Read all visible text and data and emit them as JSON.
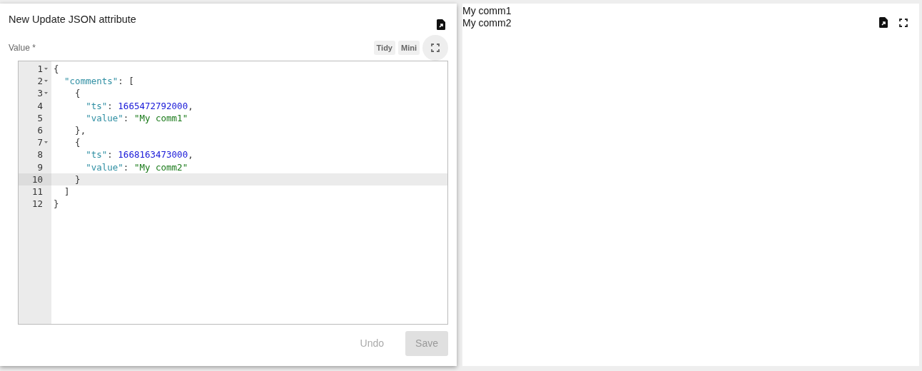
{
  "dialog": {
    "title": "New Update JSON attribute",
    "field_label": "Value *",
    "tools": [
      "Tidy",
      "Mini"
    ],
    "editor": {
      "lines": [
        {
          "number": "1",
          "fold": true,
          "active": false,
          "tokens": [
            {
              "kind": "punct",
              "text": "{"
            }
          ]
        },
        {
          "number": "2",
          "fold": true,
          "active": false,
          "tokens": [
            {
              "kind": "key",
              "text": "  \"comments\""
            },
            {
              "kind": "punct",
              "text": ": ["
            }
          ]
        },
        {
          "number": "3",
          "fold": true,
          "active": false,
          "tokens": [
            {
              "kind": "punct",
              "text": "    {"
            }
          ]
        },
        {
          "number": "4",
          "fold": false,
          "active": false,
          "tokens": [
            {
              "kind": "key",
              "text": "      \"ts\""
            },
            {
              "kind": "punct",
              "text": ": "
            },
            {
              "kind": "number",
              "text": "1665472792000"
            },
            {
              "kind": "punct",
              "text": ","
            }
          ]
        },
        {
          "number": "5",
          "fold": false,
          "active": false,
          "tokens": [
            {
              "kind": "key",
              "text": "      \"value\""
            },
            {
              "kind": "punct",
              "text": ": "
            },
            {
              "kind": "string",
              "text": "\"My comm1\""
            }
          ]
        },
        {
          "number": "6",
          "fold": false,
          "active": false,
          "tokens": [
            {
              "kind": "punct",
              "text": "    },"
            }
          ]
        },
        {
          "number": "7",
          "fold": true,
          "active": false,
          "tokens": [
            {
              "kind": "punct",
              "text": "    {"
            }
          ]
        },
        {
          "number": "8",
          "fold": false,
          "active": false,
          "tokens": [
            {
              "kind": "key",
              "text": "      \"ts\""
            },
            {
              "kind": "punct",
              "text": ": "
            },
            {
              "kind": "number",
              "text": "1668163473000"
            },
            {
              "kind": "punct",
              "text": ","
            }
          ]
        },
        {
          "number": "9",
          "fold": false,
          "active": false,
          "tokens": [
            {
              "kind": "key",
              "text": "      \"value\""
            },
            {
              "kind": "punct",
              "text": ": "
            },
            {
              "kind": "string",
              "text": "\"My comm2\""
            }
          ]
        },
        {
          "number": "10",
          "fold": false,
          "active": true,
          "tokens": [
            {
              "kind": "punct",
              "text": "    }"
            }
          ]
        },
        {
          "number": "11",
          "fold": false,
          "active": false,
          "tokens": [
            {
              "kind": "punct",
              "text": "  ]"
            }
          ]
        },
        {
          "number": "12",
          "fold": false,
          "active": false,
          "tokens": [
            {
              "kind": "punct",
              "text": "}"
            }
          ]
        }
      ]
    },
    "actions": [
      {
        "label": "Undo",
        "kind": "text",
        "disabled": true
      },
      {
        "label": "Save",
        "kind": "filled",
        "disabled": true
      }
    ]
  },
  "preview": {
    "lines": [
      "My comm1",
      "My comm2"
    ]
  }
}
